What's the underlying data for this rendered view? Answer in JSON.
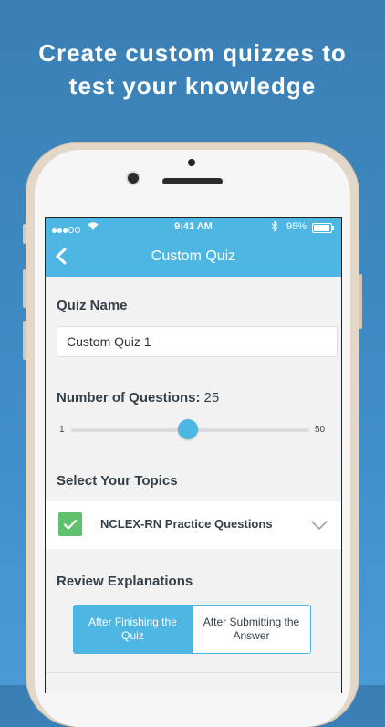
{
  "promo": {
    "line1": "Create custom quizzes to",
    "line2": "test your knowledge"
  },
  "status_bar": {
    "time": "9:41 AM",
    "battery": "95%",
    "battery_level": 0.95
  },
  "nav": {
    "title": "Custom Quiz",
    "back_icon": "chevron-left-icon"
  },
  "quiz_name": {
    "label": "Quiz Name",
    "value": "Custom Quiz 1"
  },
  "questions": {
    "label": "Number of Questions:",
    "value": "25",
    "min": "1",
    "max": "50",
    "current": 25
  },
  "topics": {
    "label": "Select Your Topics",
    "items": [
      {
        "label": "NCLEX-RN Practice Questions",
        "checked": true
      }
    ]
  },
  "review": {
    "label": "Review Explanations",
    "options": [
      {
        "label": "After Finishing the Quiz",
        "selected": true
      },
      {
        "label": "After Submitting the Answer",
        "selected": false
      }
    ]
  },
  "colors": {
    "accent": "#4db6e3",
    "check": "#5fc16b",
    "background": "#3f8cc6"
  }
}
